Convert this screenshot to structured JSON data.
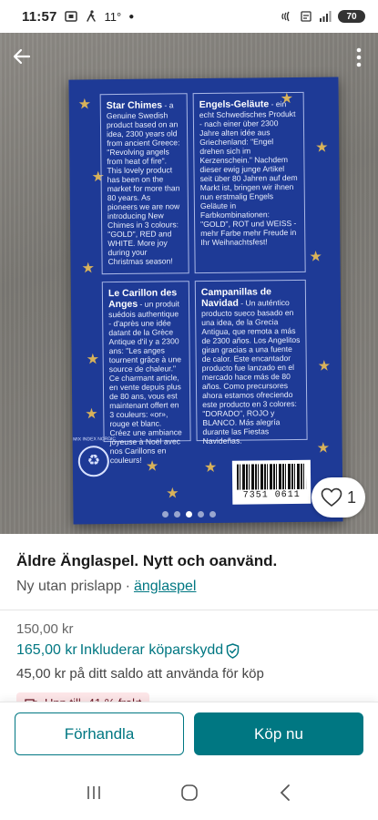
{
  "status_bar": {
    "time": "11:57",
    "temperature": "11°",
    "battery": "70"
  },
  "product_photo": {
    "panels": [
      {
        "title": "Star Chimes",
        "text": "- a Genuine Swedish product based on an idea, 2300 years old from ancient Greece: \"Revolving angels from heat of fire\". This lovely product has been on the market for more than 80 years. As pioneers we are now introducing New Chimes in 3 colours: \"GOLD\", RED and WHITE. More joy during your Christmas season!"
      },
      {
        "title": "Engels-Geläute",
        "text": "- ein echt Schwedisches Produkt - nach einer über 2300 Jahre alten idée aus Griechenland: \"Engel drehen sich im Kerzenschein.\" Nachdem dieser ewig junge Artikel seit über 80 Jahren auf dem Markt ist, bringen wir ihnen nun erstmalig Engels Geläute in Farbkombinationen: \"GOLD\", ROT und WEISS - mehr Farbe mehr Freude in Ihr Weihnachtsfest!"
      },
      {
        "title": "Le Carillon des Anges",
        "text": "- un produit suédois authentique - d'après une idée datant de la Grèce Antique d'il y a 2300 ans: \"Les anges tournent grâce à une source de chaleur.\" Ce charmant article, en vente depuis plus de 80 ans, vous est maintenant offert en 3 couleurs: «or», rouge et blanc. Créez une ambiance joyeuse à Noël avec nos Carillons en couleurs!"
      },
      {
        "title": "Campanillas de Navidad",
        "text": "- Un auténtico producto sueco basado en una idea, de la Grecia Antigua, que remota a más de 2300 años. Los Angelitos giran gracias a una fuente de calor. Este encantador producto fue lanzado en el mercado hace más de 80 años. Como precursores ahora estamos ofreciendo este producto en 3 colores: \"DORADO\", ROJO y BLANCO. Más alegría durante las Fiestas Navideñas."
      }
    ],
    "barcode_number": "7351 0611",
    "recycle_text": "MIX INDEX NORDIC",
    "like_count": "1",
    "photo_count": 5,
    "active_photo_index": 2
  },
  "item": {
    "title": "Äldre Änglaspel. Nytt och oanvänd.",
    "condition": "Ny utan prislapp",
    "separator": "·",
    "category_link": "änglaspel",
    "price": "150,00 kr",
    "buyer_price": "165,00 kr",
    "buyer_protection": "Inkluderar köparskydd",
    "balance_note": "45,00 kr på ditt saldo att använda för köp",
    "promo": "Upp till -41 % frakt"
  },
  "actions": {
    "negotiate": "Förhandla",
    "buy_now": "Köp nu"
  },
  "colors": {
    "brand": "#007782",
    "box_blue": "#1e3a96",
    "star_gold": "#d8b25a",
    "promo_bg": "#fde6e8"
  }
}
